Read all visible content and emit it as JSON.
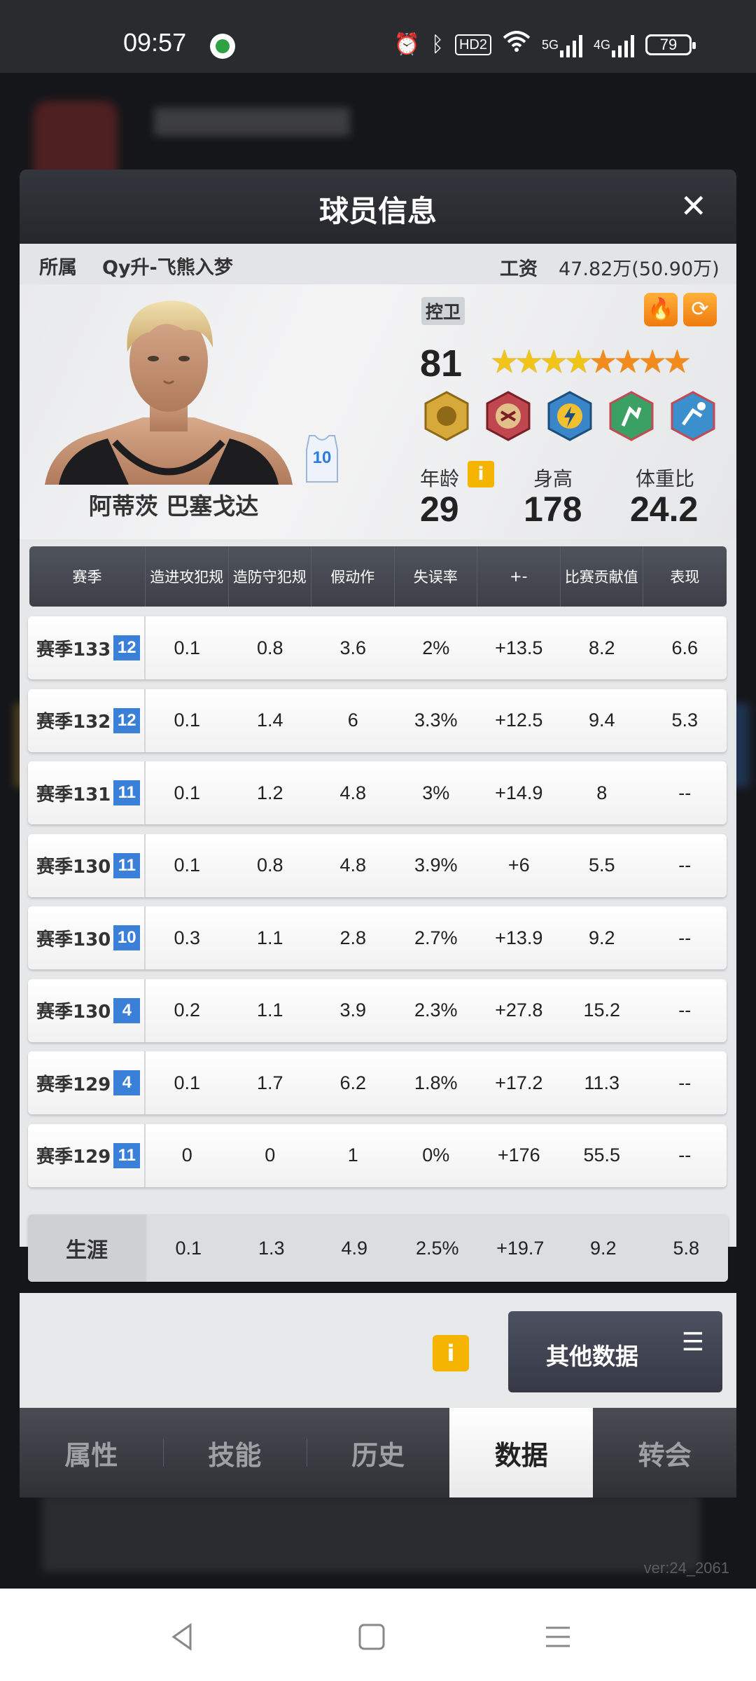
{
  "status": {
    "time": "09:57",
    "hd_label": "HD2",
    "net1": "5G",
    "net2": "4G",
    "battery": "79"
  },
  "modal": {
    "title": "球员信息",
    "close": "✕"
  },
  "club": {
    "label": "所属",
    "name": "Qy升-飞熊入梦",
    "salary_label": "工资",
    "salary_value": "47.82万(50.90万)"
  },
  "player": {
    "name": "阿蒂茨 巴塞戈达",
    "jersey_number": "10",
    "position": "控卫",
    "rating": "81",
    "stars": {
      "filled": 8,
      "yellow": 4
    },
    "badges": [
      "defense-badge-icon",
      "fist-badge-icon",
      "speed-badge-icon",
      "dunk-badge-icon",
      "shoot-badge-icon"
    ],
    "age_label": "年龄",
    "age": "29",
    "height_label": "身高",
    "height": "178",
    "weight_ratio_label": "体重比",
    "weight_ratio": "24.2",
    "info_icon": "i"
  },
  "table": {
    "headers": [
      "赛季",
      "造进攻犯规",
      "造防守犯规",
      "假动作",
      "失误率",
      "+-",
      "比赛贡献值",
      "表现"
    ],
    "rows": [
      {
        "season": "赛季133",
        "tag": "12",
        "values": [
          "0.1",
          "0.8",
          "3.6",
          "2%",
          "+13.5",
          "8.2",
          "6.6"
        ]
      },
      {
        "season": "赛季132",
        "tag": "12",
        "values": [
          "0.1",
          "1.4",
          "6",
          "3.3%",
          "+12.5",
          "9.4",
          "5.3"
        ]
      },
      {
        "season": "赛季131",
        "tag": "11",
        "values": [
          "0.1",
          "1.2",
          "4.8",
          "3%",
          "+14.9",
          "8",
          "--"
        ]
      },
      {
        "season": "赛季130",
        "tag": "11",
        "values": [
          "0.1",
          "0.8",
          "4.8",
          "3.9%",
          "+6",
          "5.5",
          "--"
        ]
      },
      {
        "season": "赛季130",
        "tag": "10",
        "values": [
          "0.3",
          "1.1",
          "2.8",
          "2.7%",
          "+13.9",
          "9.2",
          "--"
        ]
      },
      {
        "season": "赛季130",
        "tag": "4",
        "values": [
          "0.2",
          "1.1",
          "3.9",
          "2.3%",
          "+27.8",
          "15.2",
          "--"
        ]
      },
      {
        "season": "赛季129",
        "tag": "4",
        "values": [
          "0.1",
          "1.7",
          "6.2",
          "1.8%",
          "+17.2",
          "11.3",
          "--"
        ]
      },
      {
        "season": "赛季129",
        "tag": "11",
        "values": [
          "0",
          "0",
          "1",
          "0%",
          "+176",
          "55.5",
          "--"
        ]
      }
    ],
    "career": {
      "label": "生涯",
      "values": [
        "0.1",
        "1.3",
        "4.9",
        "2.5%",
        "+19.7",
        "9.2",
        "5.8"
      ]
    }
  },
  "actions": {
    "info_icon": "i",
    "other_data_label": "其他数据",
    "other_data_icon": "☰"
  },
  "tabs": [
    "属性",
    "技能",
    "历史",
    "数据",
    "转会"
  ],
  "active_tab": 3,
  "version": "ver:24_2061"
}
